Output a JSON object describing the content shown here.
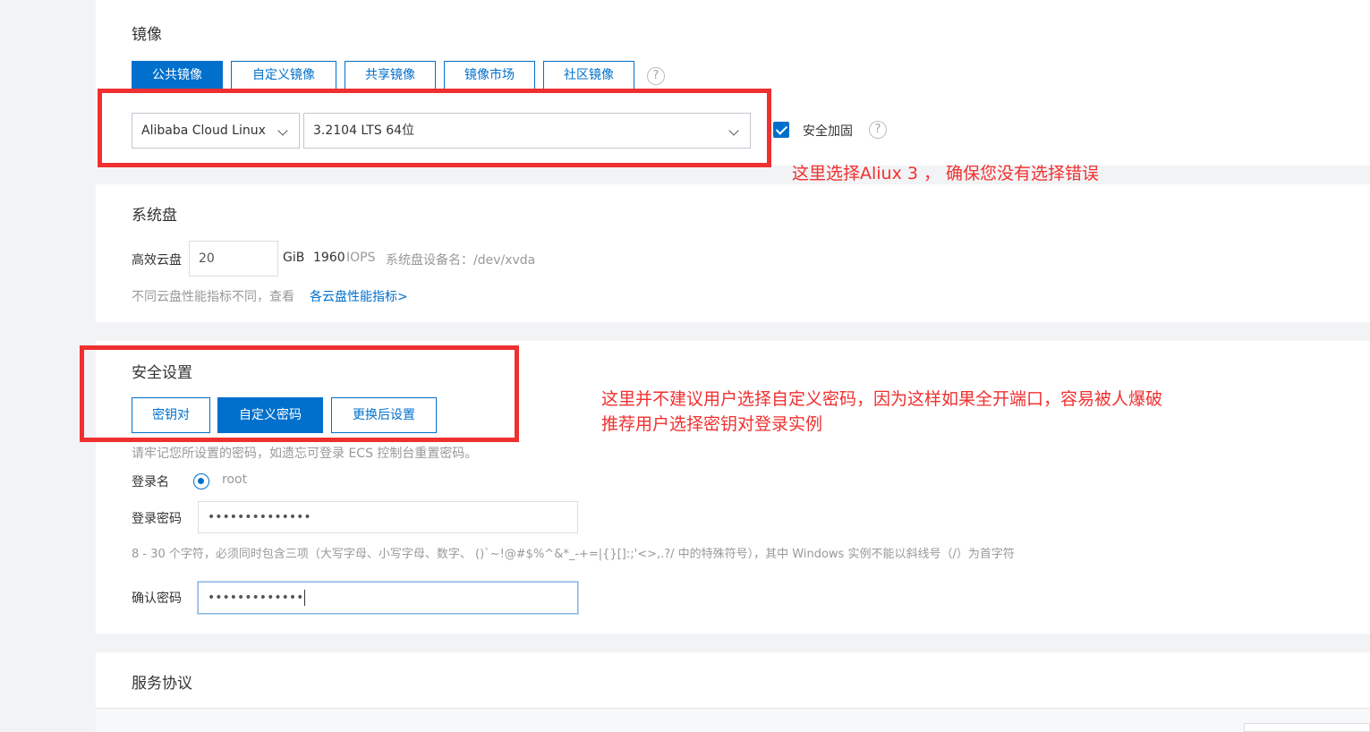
{
  "image": {
    "title": "镜像",
    "tabs": [
      "公共镜像",
      "自定义镜像",
      "共享镜像",
      "镜像市场",
      "社区镜像"
    ],
    "active_tab": 0,
    "os_select": "Alibaba Cloud Linux",
    "version_select": "3.2104 LTS 64位",
    "security_label": "安全加固",
    "security_checked": true,
    "help_glyph": "?",
    "annotation": "这里选择Aliux 3 ， 确保您没有选择错误"
  },
  "disk": {
    "title": "系统盘",
    "type_label": "高效云盘",
    "size_value": "20",
    "unit": "GiB",
    "iops_value": "1960",
    "iops_label": "IOPS",
    "device_label": "系统盘设备名：/dev/xvda",
    "hint_text": "不同云盘性能指标不同，查看",
    "hint_link": "各云盘性能指标>"
  },
  "security": {
    "title": "安全设置",
    "tabs": [
      "密钥对",
      "自定义密码",
      "更换后设置"
    ],
    "active_tab": 1,
    "reminder": "请牢记您所设置的密码，如遗忘可登录 ECS 控制台重置密码。",
    "login_name_label": "登录名",
    "login_name_value": "root",
    "password_label": "登录密码",
    "password_value": "••••••••••••••",
    "password_rule": "8 - 30 个字符，必须同时包含三项（大写字母、小写字母、数字、 ()`~!@#$%^&*_-+=|{}[]:;'<>,.?/ 中的特殊符号），其中 Windows 实例不能以斜线号（/）为首字符",
    "confirm_label": "确认密码",
    "confirm_value": "•••••••••••••",
    "annotation_line1": "这里并不建议用户选择自定义密码，因为这样如果全开端口，容易被人爆破",
    "annotation_line2": "推荐用户选择密钥对登录实例"
  },
  "agreement": {
    "title": "服务协议"
  },
  "colors": {
    "accent": "#0070cc",
    "annotation_red": "#f03030",
    "background": "#f2f3f5"
  }
}
